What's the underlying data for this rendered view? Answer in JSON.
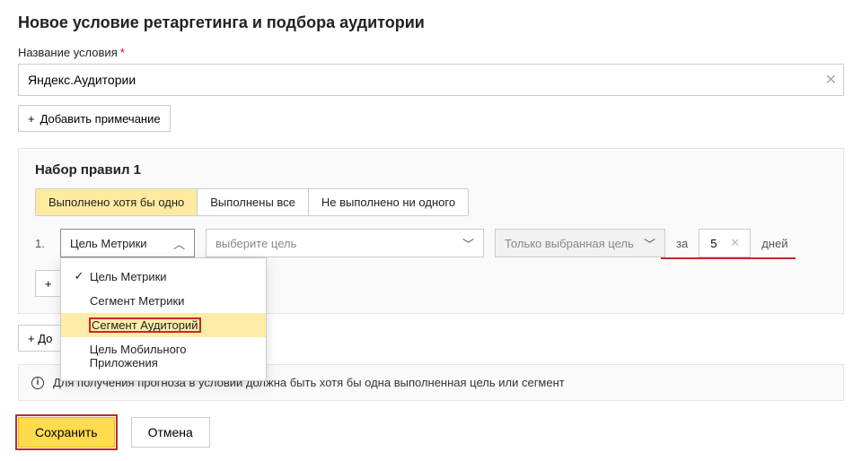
{
  "page_title": "Новое условие ретаргетинга и подбора аудитории",
  "name_field": {
    "label": "Название условия",
    "value": "Яндекс.Аудитории"
  },
  "add_note_label": "Добавить примечание",
  "ruleset": {
    "title": "Набор правил 1",
    "modes": {
      "any": "Выполнено хотя бы одно",
      "all": "Выполнены все",
      "none": "Не выполнено ни одного"
    },
    "rule_number": "1.",
    "source_selected": "Цель Метрики",
    "source_options": {
      "metric_goal": "Цель Метрики",
      "metric_segment": "Сегмент Метрики",
      "audience_segment": "Сегмент Аудиторий",
      "mobile_app_goal": "Цель Мобильного Приложения"
    },
    "goal_placeholder": "выберите цель",
    "scope_label": "Только выбранная цель",
    "days_prefix": "за",
    "days_value": "5",
    "days_suffix": "дней",
    "add_rule_label": "+",
    "add_set_label": "+ До"
  },
  "info_text": "Для получения прогноза в условии должна быть хотя бы одна выполненная цель или сегмент",
  "footer": {
    "save": "Сохранить",
    "cancel": "Отмена"
  }
}
